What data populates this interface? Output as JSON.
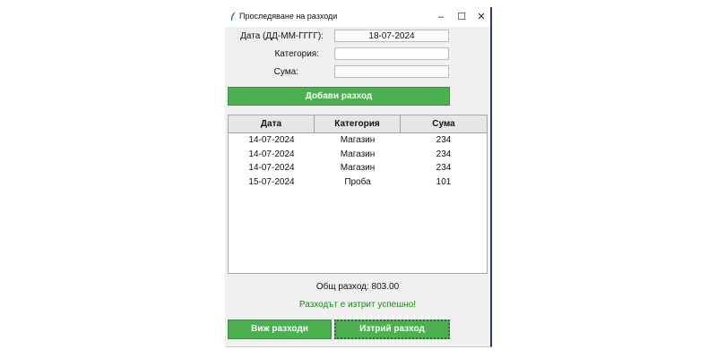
{
  "window": {
    "title": "Проследяване на разходи",
    "minimize_glyph": "–",
    "maximize_glyph": "☐",
    "close_glyph": "✕",
    "icon": "feather-icon"
  },
  "form": {
    "date_label": "Дата (ДД-ММ-ГГГГ):",
    "date_value": "18-07-2024",
    "category_label": "Категория:",
    "category_value": "",
    "amount_label": "Сума:",
    "amount_value": "",
    "add_button": "Добави разход"
  },
  "table": {
    "columns": [
      "Дата",
      "Категория",
      "Сума"
    ],
    "rows": [
      {
        "date": "14-07-2024",
        "category": "Магазин",
        "amount": "234"
      },
      {
        "date": "14-07-2024",
        "category": "Магазин",
        "amount": "234"
      },
      {
        "date": "14-07-2024",
        "category": "Магазин",
        "amount": "234"
      },
      {
        "date": "15-07-2024",
        "category": "Проба",
        "amount": "101"
      }
    ]
  },
  "summary": {
    "total": "Общ разход: 803.00",
    "status": "Разходът е изтрит успешно!"
  },
  "actions": {
    "view_button": "Виж разходи",
    "delete_button": "Изтрий разход"
  },
  "colors": {
    "button_green": "#4caf50",
    "status_green": "#1a8a1a"
  }
}
